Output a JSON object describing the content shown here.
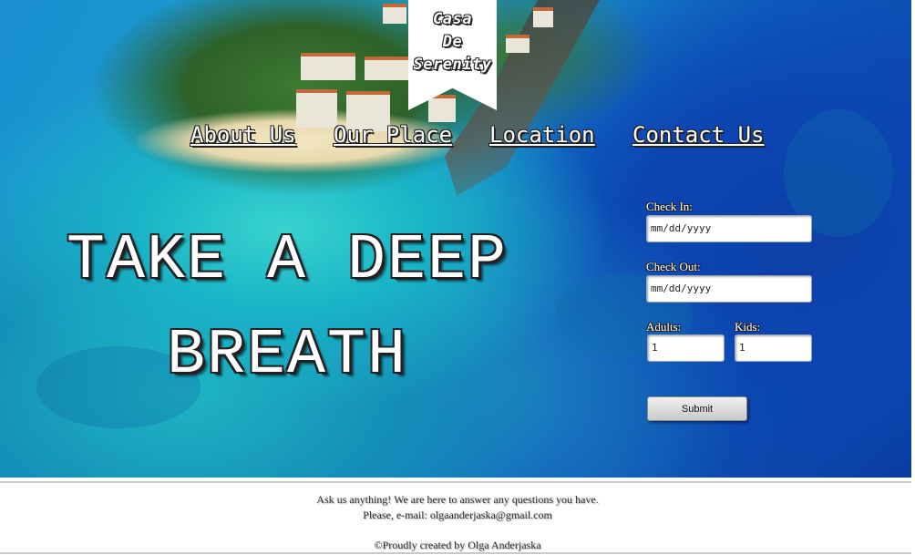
{
  "logo": {
    "line1": "Casa",
    "line2": "De",
    "line3": "Serenity"
  },
  "nav": [
    {
      "label": "About Us"
    },
    {
      "label": "Our Place"
    },
    {
      "label": "Location"
    },
    {
      "label": "Contact Us"
    }
  ],
  "hero": {
    "line1": "TAKE A DEEP",
    "line2": "BREATH"
  },
  "booking": {
    "check_in_label": "Check In:",
    "check_in_placeholder": "mm/dd/yyyy",
    "check_out_label": "Check Out:",
    "check_out_placeholder": "mm/dd/yyyy",
    "adults_label": "Adults:",
    "adults_value": "1",
    "kids_label": "Kids:",
    "kids_value": "1",
    "submit_label": "Submit"
  },
  "footer": {
    "line1": "Ask us anything! We are here to answer any questions you have.",
    "line2": "Please, e-mail: olgaanderjaska@gmail.com",
    "credit": "©Proudly created by Olga Anderjaska"
  },
  "colors": {
    "ocean_deep": "#0b46b3",
    "lagoon": "#1ab3c7",
    "text_light": "#ffffff"
  }
}
